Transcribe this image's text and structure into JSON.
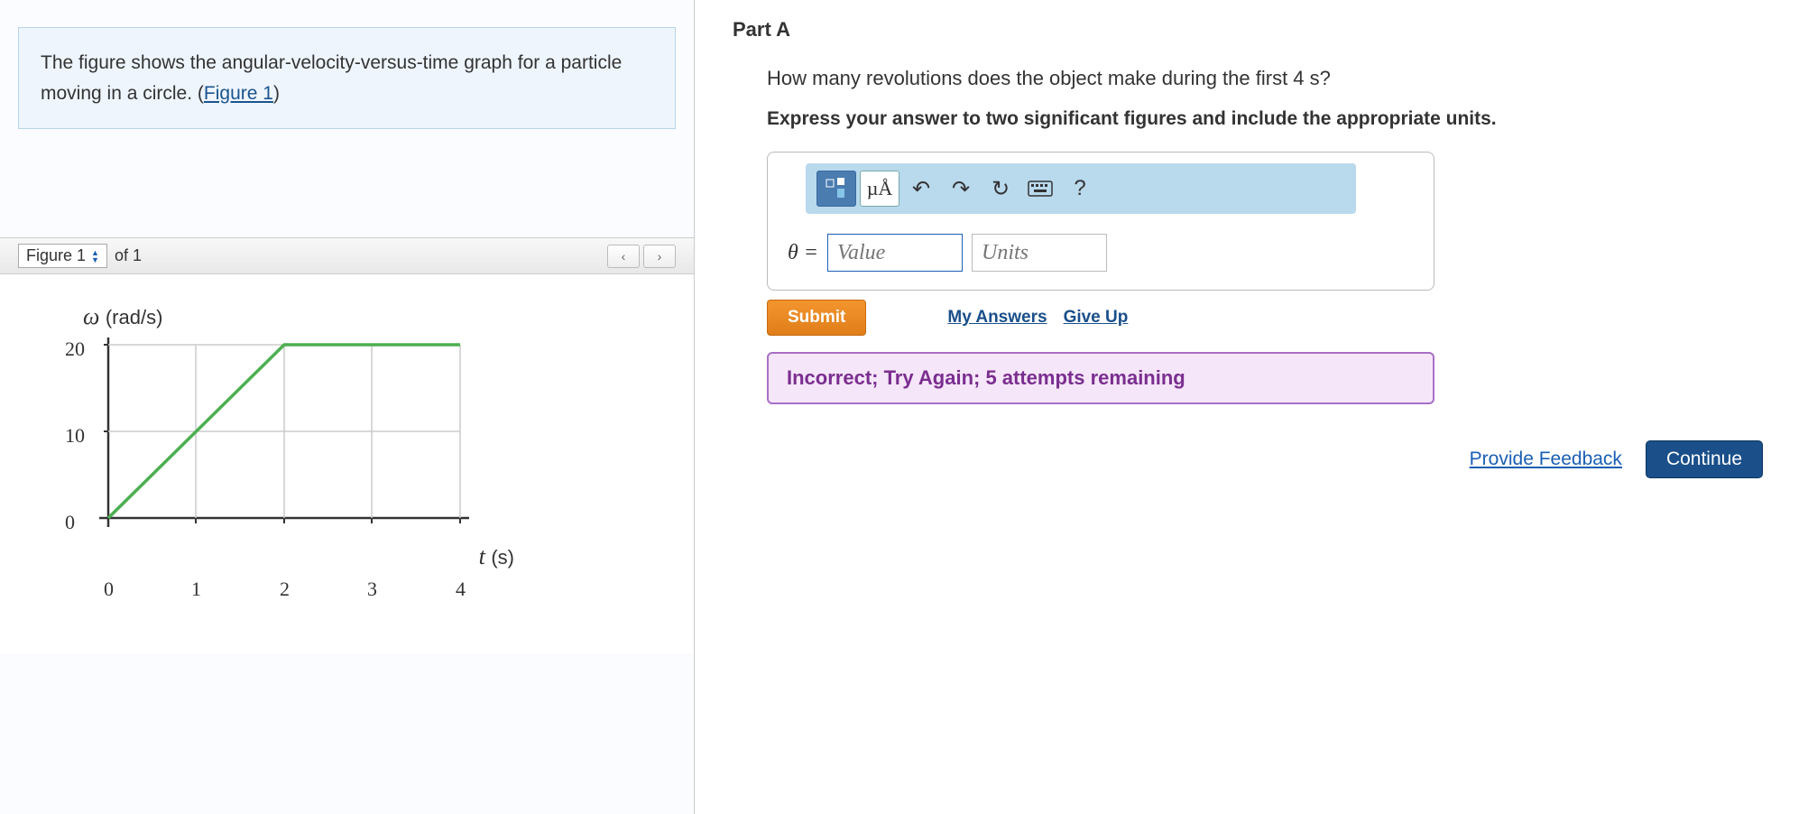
{
  "problem": {
    "description_pre": "The figure shows the angular-velocity-versus-time graph for a particle moving in a circle. (",
    "figure_link": "Figure 1",
    "description_post": ")"
  },
  "figure_bar": {
    "selector_label": "Figure 1",
    "of_text": "of 1"
  },
  "chart_data": {
    "type": "line",
    "ylabel": "ω",
    "ylabel_unit": "(rad/s)",
    "xlabel": "t",
    "xlabel_unit": "(s)",
    "x": [
      0,
      1,
      2,
      3,
      4
    ],
    "y": [
      0,
      10,
      20,
      20,
      20
    ],
    "xticks": [
      0,
      1,
      2,
      3,
      4
    ],
    "yticks": [
      0,
      10,
      20
    ],
    "xlim": [
      0,
      4
    ],
    "ylim": [
      0,
      22
    ]
  },
  "part": {
    "title": "Part A",
    "question": "How many revolutions does the object make during the first 4 s?",
    "instruction": "Express your answer to two significant figures and include the appropriate units."
  },
  "toolbar": {
    "units_label": "µÅ",
    "help_label": "?"
  },
  "answer": {
    "var_symbol": "θ =",
    "value_placeholder": "Value",
    "units_placeholder": "Units"
  },
  "actions": {
    "submit": "Submit",
    "my_answers": "My Answers",
    "give_up": "Give Up"
  },
  "feedback": {
    "message": "Incorrect; Try Again; 5 attempts remaining"
  },
  "footer": {
    "provide_feedback": "Provide Feedback",
    "continue": "Continue"
  }
}
